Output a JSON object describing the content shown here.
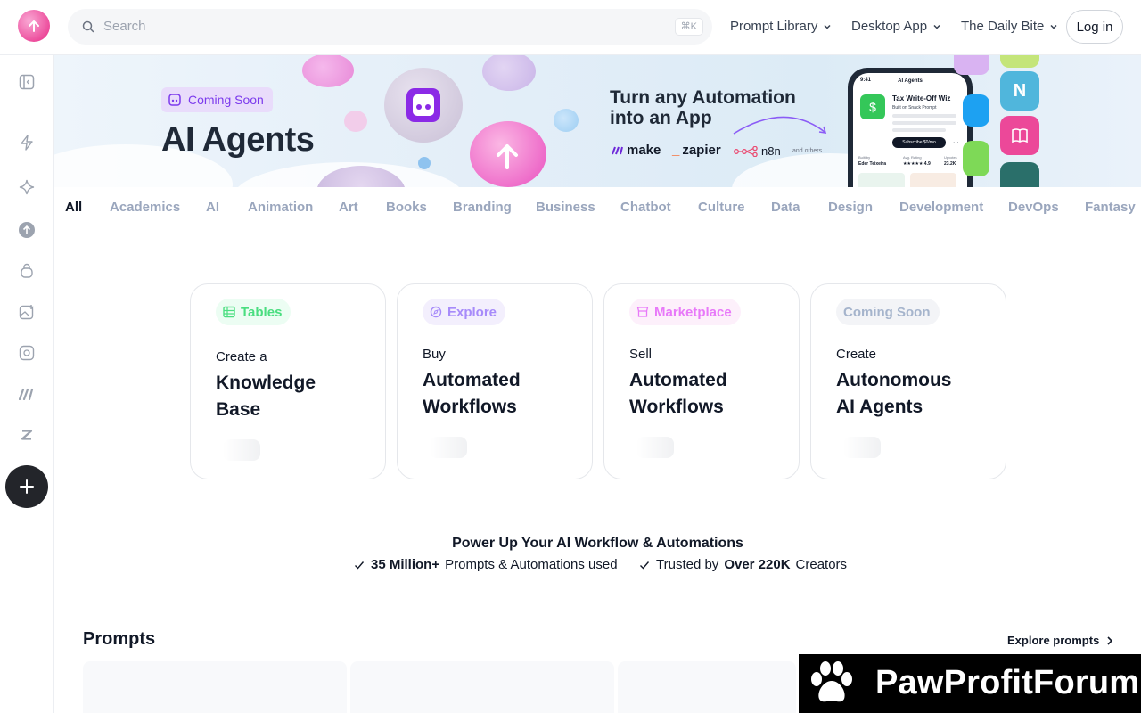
{
  "header": {
    "search_placeholder": "Search",
    "search_shortcut": "⌘K",
    "nav": [
      {
        "label": "Prompt Library"
      },
      {
        "label": "Desktop App"
      },
      {
        "label": "The Daily Bite"
      }
    ],
    "login_label": "Log in"
  },
  "banner": {
    "tag": "Coming Soon",
    "title": "AI Agents",
    "headline_line1": "Turn any Automation",
    "headline_line2": "into an App",
    "brands": [
      "make",
      "zapier",
      "n8n"
    ],
    "others": "and others",
    "phone": {
      "time": "9:41",
      "header": "AI Agents",
      "app_name": "Tax Write-Off Wiz",
      "app_sub": "Built on Snack Prompt",
      "subscribe": "Subscribe $0/mo",
      "built_by_label": "Built by",
      "built_by": "Eder Teixeira",
      "rating_label": "Avg. Rating",
      "rating": "★★★★★ 4.9",
      "upvotes_label": "Upvotes",
      "upvotes": "23.2K"
    }
  },
  "categories": [
    "All",
    "Academics",
    "AI",
    "Animation",
    "Art",
    "Books",
    "Branding",
    "Business",
    "Chatbot",
    "Culture",
    "Data",
    "Design",
    "Development",
    "DevOps",
    "Fantasy"
  ],
  "cards": [
    {
      "pill": "Tables",
      "small": "Create a",
      "big1": "Knowledge",
      "big2": "Base",
      "pill_color": "#22c55e",
      "pill_bg": "#ecfdf3"
    },
    {
      "pill": "Explore",
      "small": "Buy",
      "big1": "Automated",
      "big2": "Workflows",
      "pill_color": "#8b5cf6",
      "pill_bg": "#f3effd"
    },
    {
      "pill": "Marketplace",
      "small": "Sell",
      "big1": "Automated",
      "big2": "Workflows",
      "pill_color": "#e879f9",
      "pill_bg": "#fdf0fb"
    },
    {
      "pill": "Coming Soon",
      "small": "Create",
      "big1": "Autonomous",
      "big2": "AI Agents",
      "pill_color": "#a5b4cc",
      "pill_bg": "#f3f4f7"
    }
  ],
  "power": {
    "title": "Power Up Your AI Workflow & Automations",
    "stat1_bold": "35 Million+",
    "stat1_rest": "Prompts & Automations used",
    "stat2_pre": "Trusted by",
    "stat2_bold": "Over 220K",
    "stat2_rest": "Creators"
  },
  "prompts": {
    "title": "Prompts",
    "explore": "Explore prompts"
  },
  "watermark": {
    "text": "PawProfitForum"
  }
}
